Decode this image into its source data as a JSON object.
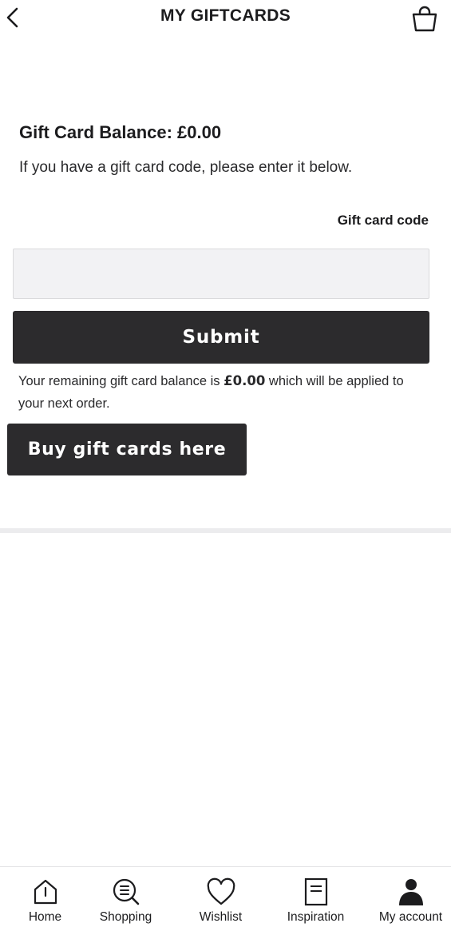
{
  "header": {
    "title": "MY GIFTCARDS",
    "back_icon": "chevron-left-icon",
    "bag_icon": "shopping-bag-icon"
  },
  "giftcard": {
    "balance_heading": "Gift Card Balance: £0.00",
    "intro": "If you have a gift card code, please enter it below.",
    "code_label": "Gift card code",
    "code_value": "",
    "submit_label": "Submit",
    "remaining_prefix": "Your remaining gift card balance is ",
    "remaining_amount": "£0.00",
    "remaining_suffix": " which will be applied to your next order.",
    "buy_label": "Buy gift cards here"
  },
  "tabbar": {
    "items": [
      {
        "label": "Home",
        "icon": "home-icon"
      },
      {
        "label": "Shopping",
        "icon": "shopping-search-icon"
      },
      {
        "label": "Wishlist",
        "icon": "heart-icon"
      },
      {
        "label": "Inspiration",
        "icon": "document-icon"
      },
      {
        "label": "My account",
        "icon": "person-icon",
        "active": true
      }
    ]
  },
  "colors": {
    "button_bg": "#2c2b2d",
    "input_bg": "#f2f2f4",
    "text": "#1c1c1e"
  }
}
